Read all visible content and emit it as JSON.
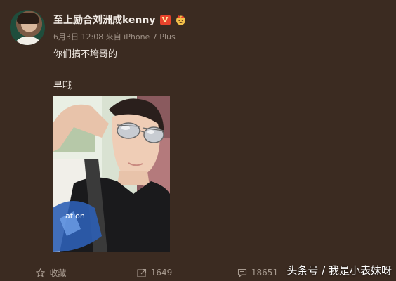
{
  "post": {
    "username": "至上励合刘洲成kenny",
    "verified_badge": "V",
    "meta": "6月3日 12:08 来自 iPhone 7 Plus",
    "text_line1": "你们搞不垮哥的",
    "text_line2": "早哦",
    "photo_shirt_text": "ation"
  },
  "actions": {
    "favorite_label": "收藏",
    "repost_count": "1649",
    "comment_count": "18651"
  },
  "watermark": "头条号 / 我是小表妹呀",
  "icons": {
    "verified": "verified-v-icon",
    "crown": "crown-badge-icon",
    "favorite": "star-icon",
    "repost": "repost-icon",
    "comment": "comment-icon"
  },
  "colors": {
    "background": "#3b2b21",
    "verified_badge": "#e8432c",
    "username": "#f2ece6",
    "meta": "#9f9186"
  }
}
